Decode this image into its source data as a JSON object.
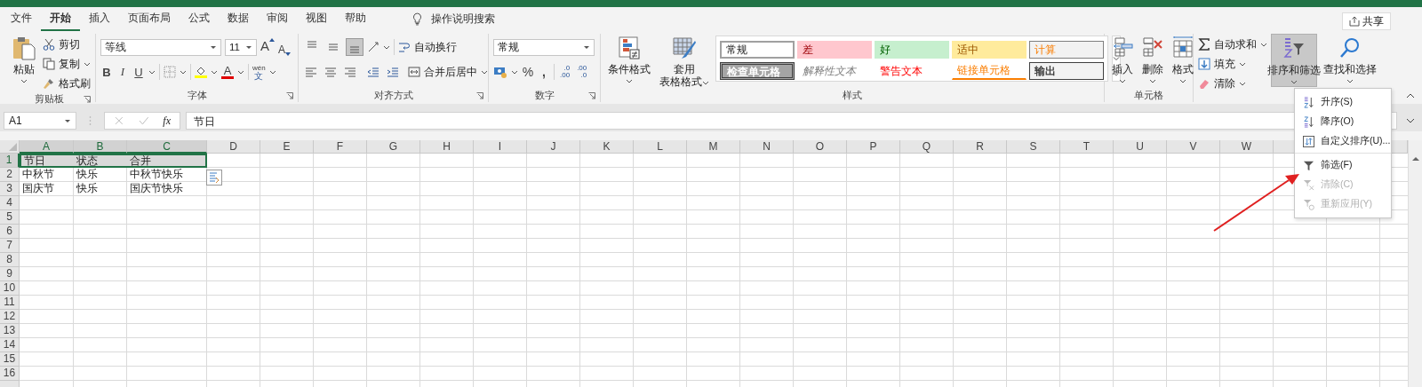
{
  "tabs": [
    {
      "label": "文件",
      "selected": false
    },
    {
      "label": "开始",
      "selected": true
    },
    {
      "label": "插入",
      "selected": false
    },
    {
      "label": "页面布局",
      "selected": false
    },
    {
      "label": "公式",
      "selected": false
    },
    {
      "label": "数据",
      "selected": false
    },
    {
      "label": "审阅",
      "selected": false
    },
    {
      "label": "视图",
      "selected": false
    },
    {
      "label": "帮助",
      "selected": false
    }
  ],
  "tell_me": {
    "label": "操作说明搜索"
  },
  "share_button": {
    "label": "共享"
  },
  "ribbon": {
    "clipboard": {
      "label": "剪贴板",
      "paste": "粘贴",
      "cut": "剪切",
      "copy": "复制",
      "format_painter": "格式刷"
    },
    "font": {
      "label": "字体",
      "font_name": "等线",
      "font_size": "11",
      "grow": "A",
      "shrink": "A",
      "bold": "B",
      "italic": "I",
      "underline": "U",
      "font_color": "A",
      "phonetic": {
        "top": "wén",
        "bottom": "文"
      }
    },
    "alignment": {
      "label": "对齐方式",
      "vertical_align": [
        {
          "selected": false
        },
        {
          "selected": false
        },
        {
          "selected": true
        }
      ],
      "wrap_text": "自动换行",
      "merge_center": "合并后居中"
    },
    "number": {
      "label": "数字",
      "format": "常规",
      "percent": "%",
      "comma": ",",
      "decimal_increase": [
        ".0",
        ".00"
      ],
      "decimal_decrease": [
        ".00",
        ".0"
      ]
    },
    "styles": {
      "label": "样式",
      "conditional_formatting": "条件格式",
      "format_as_table": [
        "套用",
        "表格格式"
      ],
      "cells": [
        {
          "label": "常规",
          "kind": "normal"
        },
        {
          "label": "差",
          "kind": "bad"
        },
        {
          "label": "好",
          "kind": "good"
        },
        {
          "label": "适中",
          "kind": "neutral"
        },
        {
          "label": "计算",
          "kind": "calculation"
        },
        {
          "label": "检查单元格",
          "kind": "check"
        },
        {
          "label": "解释性文本",
          "kind": "explanatory"
        },
        {
          "label": "警告文本",
          "kind": "warning"
        },
        {
          "label": "链接单元格",
          "kind": "linked"
        },
        {
          "label": "输出",
          "kind": "output"
        }
      ]
    },
    "cells": {
      "label": "单元格",
      "insert": "插入",
      "delete": "删除",
      "format": "格式"
    },
    "editing": {
      "autosum": "自动求和",
      "fill": "填充",
      "clear": "清除",
      "sort_filter": {
        "label": "排序和筛选",
        "selected": true
      },
      "find_select": "查找和选择"
    }
  },
  "formula_bar": {
    "name_box": "A1",
    "function_label": "fx",
    "value": "节日"
  },
  "sheet": {
    "columns": [
      {
        "label": "A",
        "selected": true
      },
      {
        "label": "B",
        "selected": true
      },
      {
        "label": "C",
        "selected": true
      },
      {
        "label": "D",
        "selected": false
      },
      {
        "label": "E",
        "selected": false
      },
      {
        "label": "F",
        "selected": false
      },
      {
        "label": "G",
        "selected": false
      },
      {
        "label": "H",
        "selected": false
      },
      {
        "label": "I",
        "selected": false
      },
      {
        "label": "J",
        "selected": false
      },
      {
        "label": "K",
        "selected": false
      },
      {
        "label": "L",
        "selected": false
      },
      {
        "label": "M",
        "selected": false
      },
      {
        "label": "N",
        "selected": false
      },
      {
        "label": "O",
        "selected": false
      },
      {
        "label": "P",
        "selected": false
      },
      {
        "label": "Q",
        "selected": false
      },
      {
        "label": "R",
        "selected": false
      },
      {
        "label": "S",
        "selected": false
      },
      {
        "label": "T",
        "selected": false
      },
      {
        "label": "U",
        "selected": false
      },
      {
        "label": "V",
        "selected": false
      },
      {
        "label": "W",
        "selected": false
      }
    ],
    "rows": [
      {
        "number": "1",
        "selected": true,
        "cells": [
          "节日",
          "状态",
          "合并"
        ]
      },
      {
        "number": "2",
        "selected": false,
        "cells": [
          "中秋节",
          "快乐",
          "中秋节快乐"
        ]
      },
      {
        "number": "3",
        "selected": false,
        "cells": [
          "国庆节",
          "快乐",
          "国庆节快乐"
        ]
      },
      {
        "number": "4",
        "selected": false,
        "cells": []
      },
      {
        "number": "5",
        "selected": false,
        "cells": []
      },
      {
        "number": "6",
        "selected": false,
        "cells": []
      },
      {
        "number": "7",
        "selected": false,
        "cells": []
      },
      {
        "number": "8",
        "selected": false,
        "cells": []
      },
      {
        "number": "9",
        "selected": false,
        "cells": []
      },
      {
        "number": "10",
        "selected": false,
        "cells": []
      },
      {
        "number": "11",
        "selected": false,
        "cells": []
      },
      {
        "number": "12",
        "selected": false,
        "cells": []
      },
      {
        "number": "13",
        "selected": false,
        "cells": []
      },
      {
        "number": "14",
        "selected": false,
        "cells": []
      },
      {
        "number": "15",
        "selected": false,
        "cells": []
      },
      {
        "number": "16",
        "selected": false,
        "cells": []
      }
    ]
  },
  "sort_menu": [
    {
      "label": "升序(S)",
      "kind": "ascending",
      "disabled": false
    },
    {
      "label": "降序(O)",
      "kind": "descending",
      "disabled": false
    },
    {
      "label": "自定义排序(U)...",
      "kind": "custom",
      "disabled": false
    },
    {
      "label": "筛选(F)",
      "kind": "filter",
      "disabled": false
    },
    {
      "label": "清除(C)",
      "kind": "clear",
      "disabled": true
    },
    {
      "label": "重新应用(Y)",
      "kind": "reapply",
      "disabled": true
    }
  ]
}
